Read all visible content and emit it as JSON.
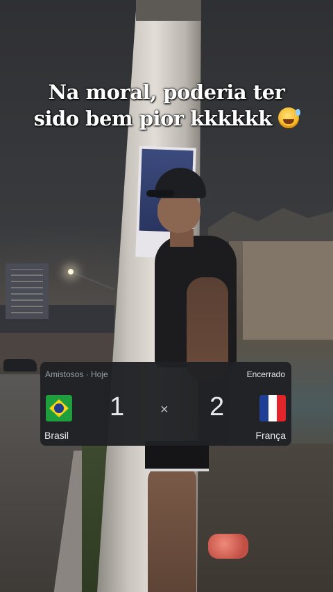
{
  "caption": {
    "line1": "Na moral, poderia ter",
    "line2": "sido bem pior kkkkkk"
  },
  "emoji_icon": "grinning-face-with-sweat",
  "match_card": {
    "competition": "Amistosos · Hoje",
    "status": "Encerrado",
    "home_team": "Brasil",
    "away_team": "França",
    "home_score": "1",
    "away_score": "2",
    "separator": "×",
    "home_flag_colors": [
      "#1e9e3c",
      "#f7d417",
      "#203c8c"
    ],
    "away_flag_colors": [
      "#1f3f95",
      "#ffffff",
      "#e2252b"
    ]
  }
}
